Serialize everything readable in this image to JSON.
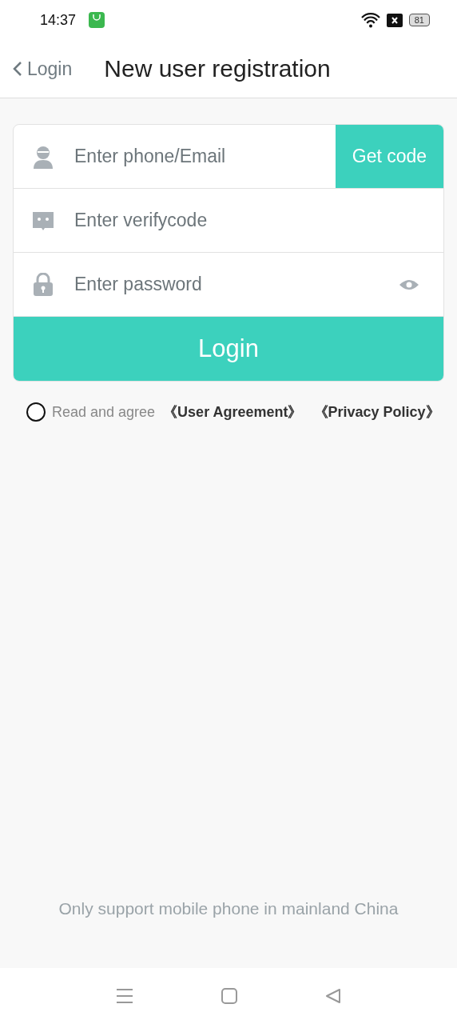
{
  "status_bar": {
    "time": "14:37",
    "battery": "81"
  },
  "header": {
    "back_label": "Login",
    "title": "New user registration"
  },
  "fields": [
    {
      "kind": "account",
      "placeholder": "Enter phone/Email",
      "action": "Get code"
    },
    {
      "kind": "code",
      "placeholder": "Enter verifycode"
    },
    {
      "kind": "password",
      "placeholder": "Enter password"
    }
  ],
  "submit": "Login",
  "agreement": {
    "checked": false,
    "text": "Read and agree",
    "links": [
      "《User Agreement》",
      "《Privacy Policy》"
    ]
  },
  "footer_note": "Only support mobile phone in mainland China"
}
